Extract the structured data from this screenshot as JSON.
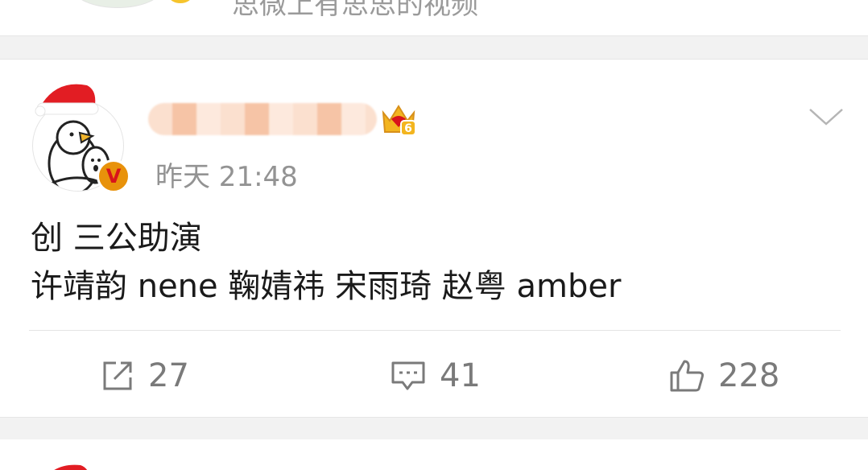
{
  "previous_post": {
    "text_fragment": "思微上有思思的视频"
  },
  "post": {
    "timestamp": "昨天 21:48",
    "verified_badge": "V",
    "crown_level": "6",
    "content_lines": [
      "创 三公助演",
      "许靖韵 nene 鞠婧祎 宋雨琦 赵粤 amber"
    ],
    "actions": {
      "forward_count": "27",
      "comment_count": "41",
      "like_count": "228"
    },
    "icons": {
      "forward": "share-arrow-icon",
      "comment": "comment-bubble-icon",
      "like": "thumbs-up-icon",
      "menu": "chevron-down-icon",
      "crown": "crown-badge-icon"
    }
  },
  "colors": {
    "background_gap": "#f2f2f2",
    "text_primary": "#1a1a1a",
    "text_secondary": "#939393",
    "action_text": "#7a7a7a",
    "badge_orange": "#e8920b",
    "badge_red": "#d8141b",
    "crown_gold": "#f3b51f"
  }
}
